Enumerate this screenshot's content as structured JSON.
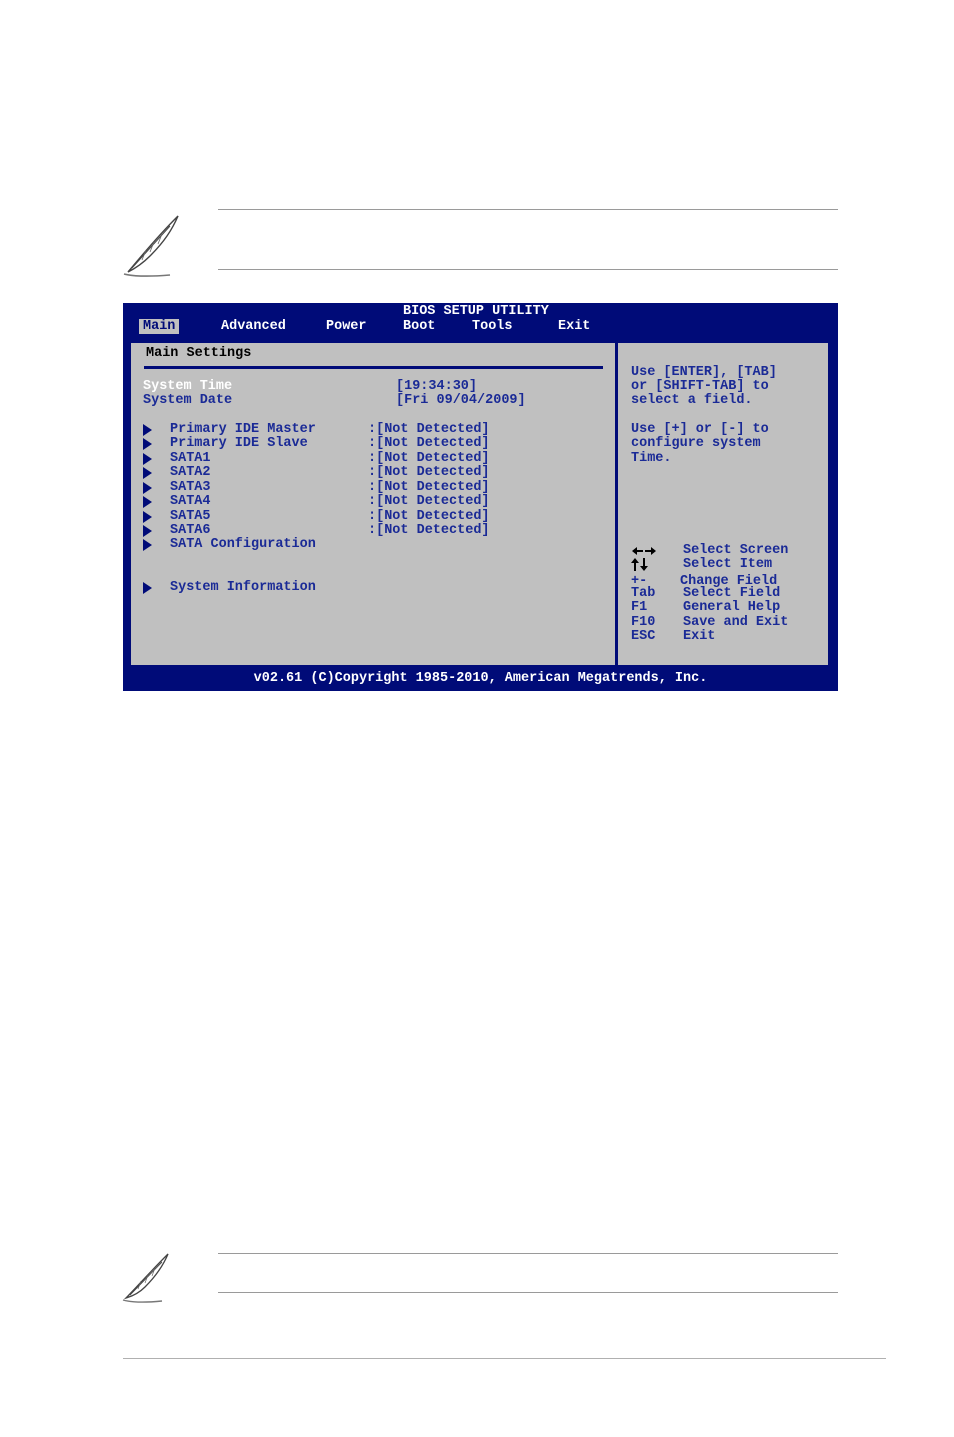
{
  "bios": {
    "title": "BIOS SETUP UTILITY",
    "menu": [
      "Main",
      "Advanced",
      "Power",
      "Boot",
      "Tools",
      "Exit"
    ],
    "section_title": "Main Settings",
    "system_time": {
      "label": "System Time",
      "value": "[19:34:30]"
    },
    "system_date": {
      "label": "System Date",
      "value": "[Fri 09/04/2009]"
    },
    "devices": [
      {
        "label": "Primary IDE Master",
        "value": ":[Not Detected]"
      },
      {
        "label": "Primary IDE Slave",
        "value": ":[Not Detected]"
      },
      {
        "label": "SATA1",
        "value": ":[Not Detected]"
      },
      {
        "label": "SATA2",
        "value": ":[Not Detected]"
      },
      {
        "label": "SATA3",
        "value": ":[Not Detected]"
      },
      {
        "label": "SATA4",
        "value": ":[Not Detected]"
      },
      {
        "label": "SATA5",
        "value": ":[Not Detected]"
      },
      {
        "label": "SATA6",
        "value": ":[Not Detected]"
      }
    ],
    "sata_configuration": "SATA Configuration",
    "system_information": "System Information",
    "help_text": [
      "Use [ENTER], [TAB]",
      "or [SHIFT-TAB] to",
      "select a field.",
      "Use [+] or [-] to",
      "configure system",
      "Time."
    ],
    "keys": [
      {
        "key": "",
        "icon": "left-right-arrows-icon",
        "desc": "Select Screen"
      },
      {
        "key": "",
        "icon": "up-down-arrows-icon",
        "desc": "Select Item"
      },
      {
        "key": "+-",
        "desc": "Change Field"
      },
      {
        "key": "Tab",
        "desc": "Select Field"
      },
      {
        "key": "F1",
        "desc": "General Help"
      },
      {
        "key": "F10",
        "desc": "Save and Exit"
      },
      {
        "key": "ESC",
        "desc": "Exit"
      }
    ],
    "footer": "v02.61 (C)Copyright 1985-2010, American Megatrends, Inc."
  },
  "icons": {
    "note_top": "feather-note-icon",
    "note_bottom": "feather-note-icon"
  },
  "colors": {
    "bios_blue": "#000b78",
    "panel_gray": "#c0c0c0",
    "text_blue": "#1a2a96",
    "highlight": "#ffffff"
  }
}
